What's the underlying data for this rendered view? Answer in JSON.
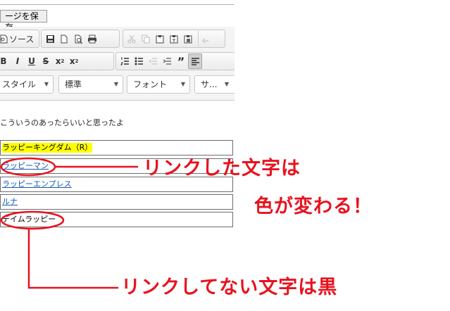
{
  "toolbar": {
    "save_label": "ージを保存",
    "source_label": "ソース"
  },
  "combos": {
    "style": "スタイル",
    "format": "標準",
    "font": "フォント",
    "size": "サ..."
  },
  "content": {
    "intro": "こういうのあったらいいと思ったよ",
    "rows": [
      "ラッピーキングダム（R）",
      "ラッピーマン",
      "ラッピーエンプレス",
      "ルナ",
      "デイムラッピー"
    ]
  },
  "annotations": {
    "linked_line1": "リンクした文字は",
    "linked_line2": "色が変わる！",
    "unlinked": "リンクしてない文字は黒"
  },
  "colors": {
    "annotation": "#e8121e",
    "link": "#1558b0",
    "highlight": "#ffff00"
  }
}
